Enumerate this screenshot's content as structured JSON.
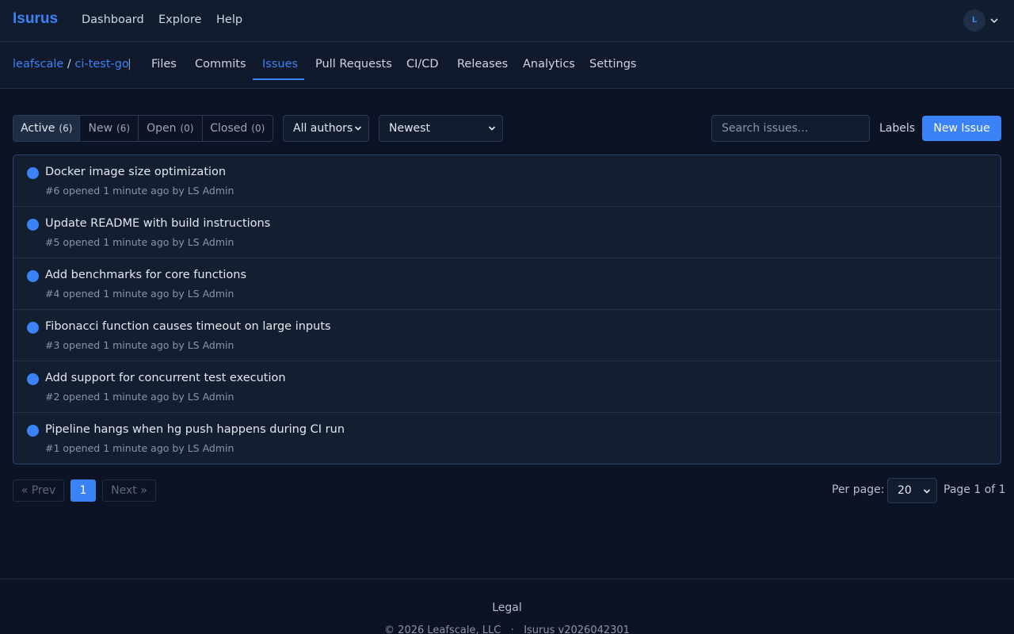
{
  "app": {
    "brand": "Isurus"
  },
  "topnav": {
    "dashboard": "Dashboard",
    "explore": "Explore",
    "help": "Help",
    "avatar_initial": "L"
  },
  "repo": {
    "owner": "leafscale",
    "sep": "/",
    "name": "ci-test-go",
    "divider": "|"
  },
  "tabs": {
    "files": "Files",
    "commits": "Commits",
    "issues": "Issues",
    "pull_requests": "Pull Requests",
    "cicd": "CI/CD",
    "releases": "Releases",
    "analytics": "Analytics",
    "settings": "Settings",
    "active": "Issues"
  },
  "filters": {
    "segments": [
      {
        "label": "Active",
        "count": "(6)"
      },
      {
        "label": "New",
        "count": "(6)"
      },
      {
        "label": "Open",
        "count": "(0)"
      },
      {
        "label": "Closed",
        "count": "(0)"
      }
    ],
    "author": "All authors",
    "sort": "Newest",
    "search_placeholder": "Search issues...",
    "labels": "Labels",
    "new_issue": "New Issue"
  },
  "issues": [
    {
      "title": "Docker image size optimization",
      "meta": "#6 opened 1 minute ago by LS Admin"
    },
    {
      "title": "Update README with build instructions",
      "meta": "#5 opened 1 minute ago by LS Admin"
    },
    {
      "title": "Add benchmarks for core functions",
      "meta": "#4 opened 1 minute ago by LS Admin"
    },
    {
      "title": "Fibonacci function causes timeout on large inputs",
      "meta": "#3 opened 1 minute ago by LS Admin"
    },
    {
      "title": "Add support for concurrent test execution",
      "meta": "#2 opened 1 minute ago by LS Admin"
    },
    {
      "title": "Pipeline hangs when hg push happens during CI run",
      "meta": "#1 opened 1 minute ago by LS Admin"
    }
  ],
  "pagination": {
    "prev": "« Prev",
    "current": "1",
    "next": "Next »",
    "per_page_label": "Per page:",
    "per_page": "20",
    "page_info": "Page 1 of 1"
  },
  "footer": {
    "legal": "Legal",
    "copyright": "© 2026 Leafscale, LLC   ·   Isurus v2026042301"
  },
  "colors": {
    "accent": "#3b82f6",
    "background": "#0b1324",
    "open_issue": "#3b82f6"
  }
}
